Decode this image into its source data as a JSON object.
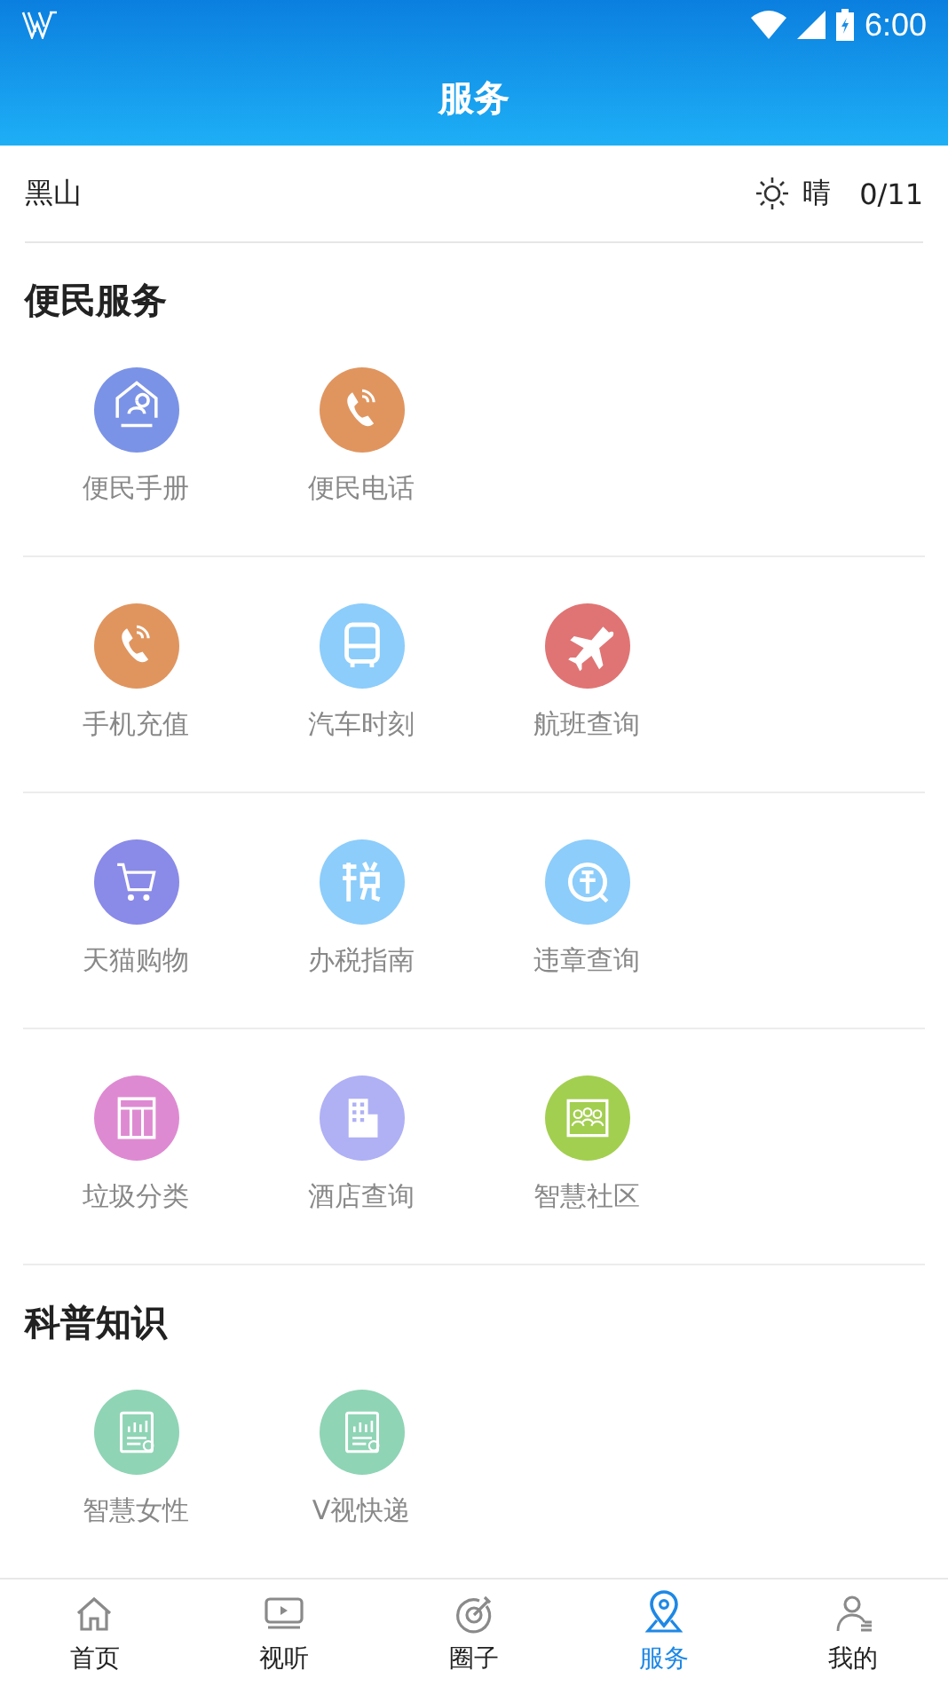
{
  "status_bar": {
    "time": "6:00"
  },
  "header": {
    "title": "服务"
  },
  "weather": {
    "location": "黑山",
    "condition": "晴",
    "temperature": "0/11"
  },
  "sections": [
    {
      "title": "便民服务",
      "rows": [
        [
          {
            "label": "便民手册",
            "kind": "house",
            "color": "#7b93e6"
          },
          {
            "label": "便民电话",
            "kind": "phone",
            "color": "#e0955f"
          }
        ],
        [
          {
            "label": "手机充值",
            "kind": "phone",
            "color": "#e0955f"
          },
          {
            "label": "汽车时刻",
            "kind": "bus",
            "color": "#8ccdfb"
          },
          {
            "label": "航班查询",
            "kind": "plane",
            "color": "#e07474"
          }
        ],
        [
          {
            "label": "天猫购物",
            "kind": "cart",
            "color": "#8a8ae8"
          },
          {
            "label": "办税指南",
            "kind": "tax",
            "color": "#8ccdfb"
          },
          {
            "label": "违章查询",
            "kind": "search",
            "color": "#8ccdfb"
          }
        ],
        [
          {
            "label": "垃圾分类",
            "kind": "cabinet",
            "color": "#de8ad2"
          },
          {
            "label": "酒店查询",
            "kind": "building",
            "color": "#b0b0f5"
          },
          {
            "label": "智慧社区",
            "kind": "people",
            "color": "#a3cf50"
          }
        ]
      ]
    },
    {
      "title": "科普知识",
      "rows": [
        [
          {
            "label": "智慧女性",
            "kind": "report",
            "color": "#8fd4b5"
          },
          {
            "label": "V视快递",
            "kind": "report",
            "color": "#8fd4b5"
          }
        ]
      ]
    }
  ],
  "nav": [
    {
      "label": "首页",
      "kind": "home",
      "selected": false
    },
    {
      "label": "视听",
      "kind": "tv",
      "selected": false
    },
    {
      "label": "圈子",
      "kind": "target",
      "selected": false
    },
    {
      "label": "服务",
      "kind": "pin",
      "selected": true
    },
    {
      "label": "我的",
      "kind": "user",
      "selected": false
    }
  ]
}
